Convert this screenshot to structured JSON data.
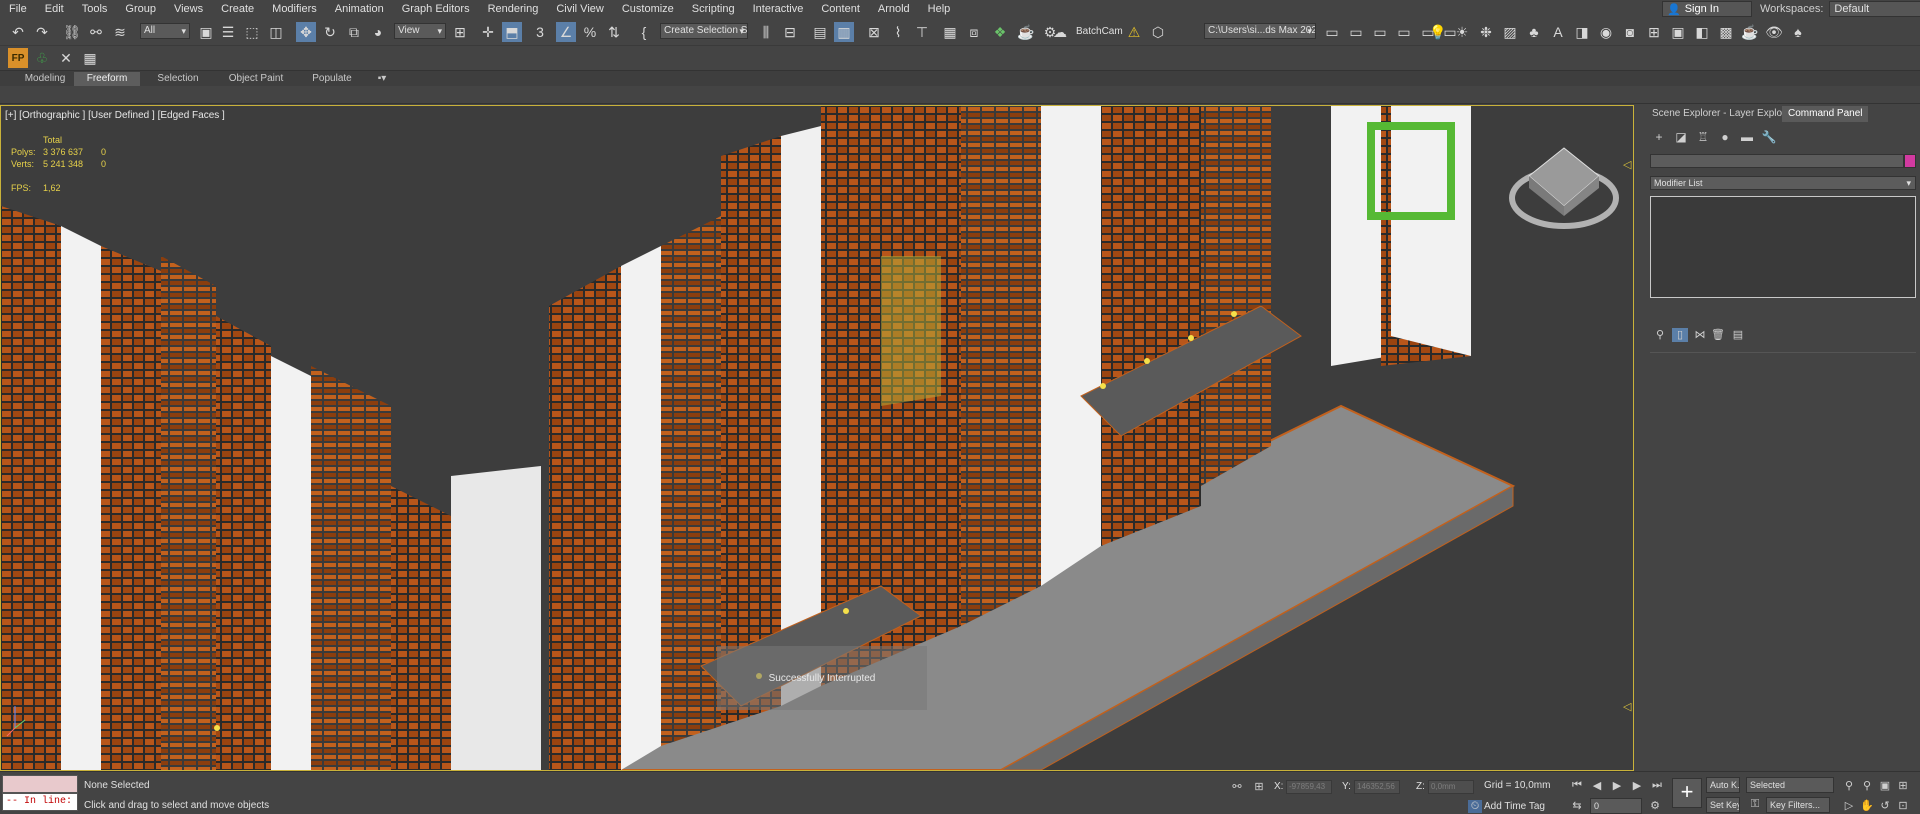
{
  "menu": [
    "File",
    "Edit",
    "Tools",
    "Group",
    "Views",
    "Create",
    "Modifiers",
    "Animation",
    "Graph Editors",
    "Rendering",
    "Civil View",
    "Customize",
    "Scripting",
    "Interactive",
    "Content",
    "Arnold",
    "Help"
  ],
  "account": {
    "signin_label": "Sign In",
    "workspaces_label": "Workspaces:",
    "workspace_value": "Default"
  },
  "toolbar": {
    "selection_filter": "All",
    "reference_coord": "View",
    "named_selection": "Create Selection Se",
    "batchcam_label": "BatchCam",
    "project_path": "C:\\Users\\si...ds Max 2021"
  },
  "ribbon": {
    "tabs": [
      "Modeling",
      "Freeform",
      "Selection",
      "Object Paint",
      "Populate"
    ],
    "active": "Freeform"
  },
  "viewport": {
    "label": "[+] [Orthographic ] [User Defined ] [Edged Faces ]",
    "stats_header": "Total",
    "polys_label": "Polys:",
    "polys_value": "3 376 637",
    "polys_sel": "0",
    "verts_label": "Verts:",
    "verts_value": "5 241 348",
    "verts_sel": "0",
    "fps_label": "FPS:",
    "fps_value": "1,62",
    "message": "Successfully Interrupted"
  },
  "panel": {
    "tabs": [
      "Scene Explorer - Layer Explorer",
      "Command Panel"
    ],
    "active_tab": "Command Panel",
    "modifier_list": "Modifier List",
    "object_color": "#d23aa0"
  },
  "status": {
    "maxscript_prompt": "-- In line:",
    "selection": "None Selected",
    "hint": "Click and drag to select and move objects",
    "x_label": "X:",
    "x_value": "-97859,43",
    "y_label": "Y:",
    "y_value": "146352,56",
    "z_label": "Z:",
    "z_value": "0,0mm",
    "grid": "Grid = 10,0mm",
    "add_time_tag": "Add Time Tag",
    "auto_key": "Auto K...",
    "key_mode": "Selected",
    "set_key": "Set Key",
    "key_filters": "Key Filters...",
    "frame": "0"
  },
  "colors": {
    "viewport_border": "#c9b23a",
    "building_orange": "#b8561a",
    "stats_yellow": "#e6d14a"
  }
}
